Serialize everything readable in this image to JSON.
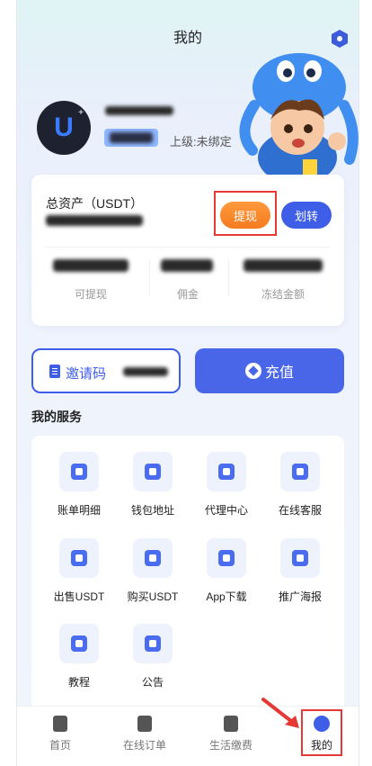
{
  "header": {
    "title": "我的"
  },
  "profile": {
    "superior_label": "上级:未绑定"
  },
  "assets": {
    "total_label": "总资产（USDT）",
    "withdraw_label": "提现",
    "transfer_label": "划转",
    "stats": [
      {
        "label": "可提现"
      },
      {
        "label": "佣金"
      },
      {
        "label": "冻结金额"
      }
    ]
  },
  "actions": {
    "invite_label": "邀请码",
    "recharge_label": "充值"
  },
  "services": {
    "title": "我的服务",
    "items": [
      {
        "label": "账单明细",
        "icon": "bill-icon"
      },
      {
        "label": "钱包地址",
        "icon": "wallet-icon"
      },
      {
        "label": "代理中心",
        "icon": "agent-icon"
      },
      {
        "label": "在线客服",
        "icon": "support-icon"
      },
      {
        "label": "出售USDT",
        "icon": "sell-usdt-icon"
      },
      {
        "label": "购买USDT",
        "icon": "buy-usdt-icon"
      },
      {
        "label": "App下载",
        "icon": "download-icon"
      },
      {
        "label": "推广海报",
        "icon": "poster-icon"
      },
      {
        "label": "教程",
        "icon": "tutorial-icon"
      },
      {
        "label": "公告",
        "icon": "announcement-icon"
      }
    ]
  },
  "nav": {
    "items": [
      {
        "label": "首页",
        "icon": "home-icon"
      },
      {
        "label": "在线订单",
        "icon": "order-icon"
      },
      {
        "label": "生活缴费",
        "icon": "bolt-icon"
      },
      {
        "label": "我的",
        "icon": "profile-icon",
        "active": true
      }
    ]
  },
  "colors": {
    "accent": "#3f5ee8",
    "withdraw": "#f57a20",
    "highlight": "#e53935"
  }
}
